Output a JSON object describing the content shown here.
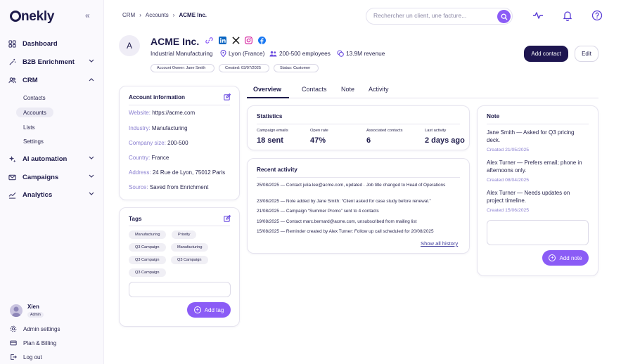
{
  "brand": {
    "logo_text": "nekly",
    "accent": "#8b5cf6",
    "dark": "#1e1650"
  },
  "sidebar": {
    "nav": [
      {
        "label": "Dashboard",
        "icon": "grid-icon"
      },
      {
        "label": "B2B Enrichment",
        "icon": "magic-wand-icon"
      },
      {
        "label": "CRM",
        "icon": "users-icon"
      },
      {
        "label": "AI automation",
        "icon": "sparkle-icon"
      },
      {
        "label": "Campaigns",
        "icon": "mail-icon"
      },
      {
        "label": "Analytics",
        "icon": "chart-icon"
      }
    ],
    "crm_sub": [
      "Contacts",
      "Accounts",
      "Lists",
      "Settings"
    ],
    "user": {
      "name": "Xien",
      "role": "Admin"
    },
    "footer": [
      "Admin settings",
      "Plan & Billing",
      "Log out"
    ]
  },
  "header": {
    "breadcrumb": [
      "CRM",
      "Accounts",
      "ACME Inc."
    ],
    "search_placeholder": "Rechercher un client, une facture..."
  },
  "account": {
    "initial": "A",
    "name": "ACME Inc.",
    "industry": "Industrial Manufacturing",
    "location": "Lyon (France)",
    "employees": "200-500 employees",
    "revenue": "13.9M revenue",
    "owner_pill": "Account Owner: Jane Smith",
    "created_pill": "Created: 03/07/2025",
    "status_pill": "Status: Customer",
    "add_contact": "Add contact",
    "edit": "Edit"
  },
  "account_info": {
    "title": "Account information",
    "fields": [
      {
        "label": "Website:",
        "value": "https://acme.com"
      },
      {
        "label": "Industry:",
        "value": "Manufacturing"
      },
      {
        "label": "Company size:",
        "value": "200-500"
      },
      {
        "label": "Country:",
        "value": "France"
      },
      {
        "label": "Address:",
        "value": "24 Rue de Lyon, 75012 Paris"
      },
      {
        "label": "Source:",
        "value": "Saved from Enrichment"
      }
    ]
  },
  "tags": {
    "title": "Tags",
    "items": [
      "Manufacturing",
      "Priority",
      "Q3 Campaign",
      "Manufacturing",
      "Q3 Campaign",
      "Q3 Campaign",
      "Q3 Campaign"
    ],
    "add_label": "Add tag"
  },
  "tabs": [
    "Overview",
    "Contacts",
    "Note",
    "Activity"
  ],
  "statistics": {
    "title": "Statistics",
    "items": [
      {
        "label": "Campaign emails",
        "value": "18 sent"
      },
      {
        "label": "Open rate",
        "value": "47%"
      },
      {
        "label": "Associated contacts",
        "value": "6"
      },
      {
        "label": "Last activity",
        "value": "2 days ago"
      }
    ]
  },
  "activity": {
    "title": "Recent activity",
    "items": [
      "25/08/2025 — Contact julia.lee@acme.com, updated · Job title changed to Head of Operations",
      "23/08/2025 — Note added by Jane Smith: “Client asked for case study before renewal.”",
      "21/08/2025 — Campaign “Summer Promo” sent to 4 contacts",
      "19/08/2025 — Contact marc.bernard@acme.com, unsubscribed from mailing list",
      "15/08/2025 — Reminder created by Alex Turner: Follow up call scheduled for 20/08/2025"
    ],
    "show_all": "Show all history"
  },
  "notes": {
    "title": "Note",
    "items": [
      {
        "text": "Jane Smith — Asked for Q3 pricing deck.",
        "date": "Created 21/05/2025"
      },
      {
        "text": "Alex Turner — Prefers email; phone in afternoons only.",
        "date": "Created 08/04/2025"
      },
      {
        "text": "Alex Turner — Needs updates on project timeline.",
        "date": "Created 15/06/2025"
      }
    ],
    "add_label": "Add note"
  }
}
